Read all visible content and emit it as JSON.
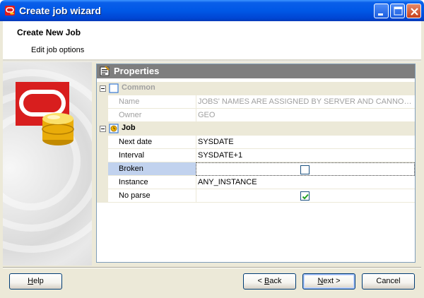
{
  "window": {
    "title": "Create job wizard"
  },
  "header": {
    "title": "Create New Job",
    "subtitle": "Edit job options"
  },
  "properties": {
    "heading": "Properties",
    "categories": {
      "common": {
        "label": "Common",
        "rows": {
          "name": {
            "label": "Name",
            "value": "JOBS' NAMES ARE ASSIGNED BY SERVER AND CANNOT ..."
          },
          "owner": {
            "label": "Owner",
            "value": "GEO"
          }
        }
      },
      "job": {
        "label": "Job",
        "rows": {
          "next_date": {
            "label": "Next date",
            "value": "SYSDATE"
          },
          "interval": {
            "label": "Interval",
            "value": "SYSDATE+1"
          },
          "broken": {
            "label": "Broken",
            "checked": false
          },
          "instance": {
            "label": "Instance",
            "value": "ANY_INSTANCE"
          },
          "no_parse": {
            "label": "No parse",
            "checked": true
          }
        }
      }
    }
  },
  "buttons": {
    "help": {
      "underline": "H",
      "rest": "elp"
    },
    "back": {
      "prefix": "< ",
      "underline": "B",
      "rest": "ack"
    },
    "next": {
      "underline": "N",
      "rest": "ext >"
    },
    "cancel": {
      "label": "Cancel"
    }
  },
  "colors": {
    "titlebar": "#0058e6",
    "selection": "#c1d2ee",
    "props_header": "#7e7e7e",
    "check_green": "#21a121"
  },
  "icons": {
    "app": "oracle-logo-icon",
    "minimize": "minimize-icon",
    "maximize": "maximize-icon",
    "close": "close-icon",
    "properties": "properties-icon",
    "common": "common-category-icon",
    "job": "job-category-icon",
    "wizard_art": "database-icon"
  }
}
